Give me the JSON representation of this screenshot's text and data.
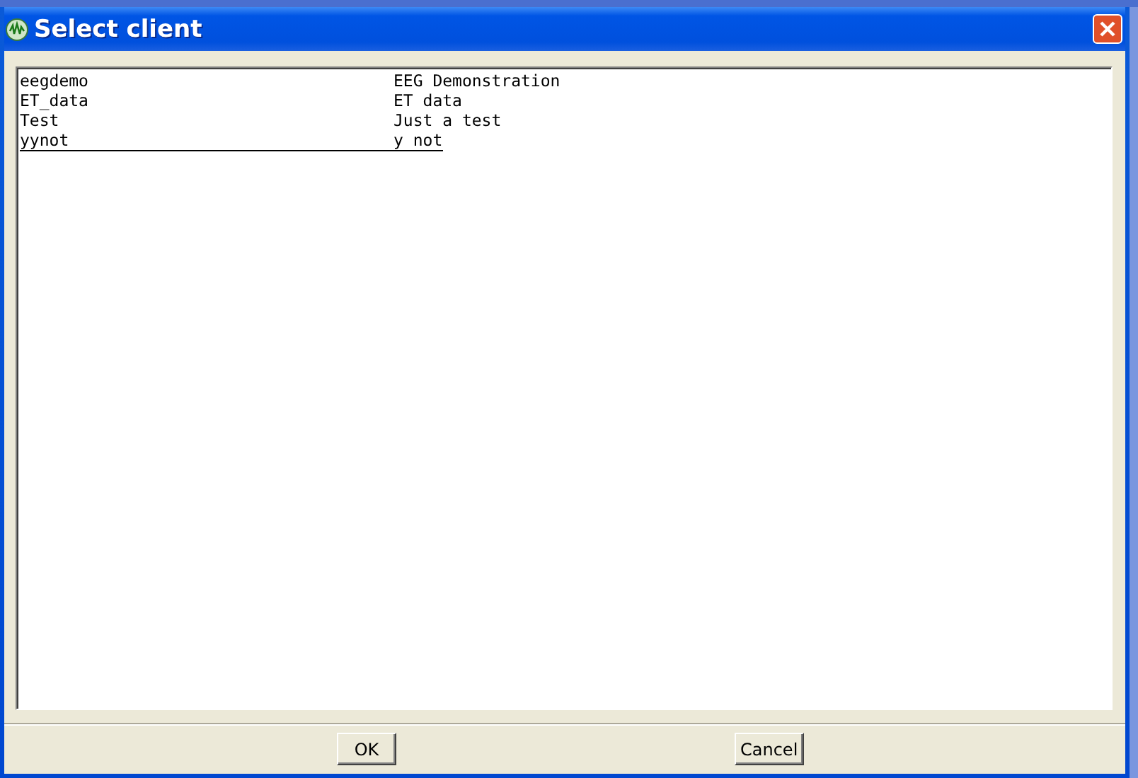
{
  "window": {
    "title": "Select client"
  },
  "clients": [
    {
      "name": "eegdemo",
      "description": "EEG Demonstration",
      "selected": false
    },
    {
      "name": "ET_data",
      "description": "ET data",
      "selected": false
    },
    {
      "name": "Test",
      "description": "Just a test",
      "selected": false
    },
    {
      "name": "yynot",
      "description": "y not",
      "selected": true
    }
  ],
  "buttons": [
    "OK",
    "Cancel"
  ]
}
